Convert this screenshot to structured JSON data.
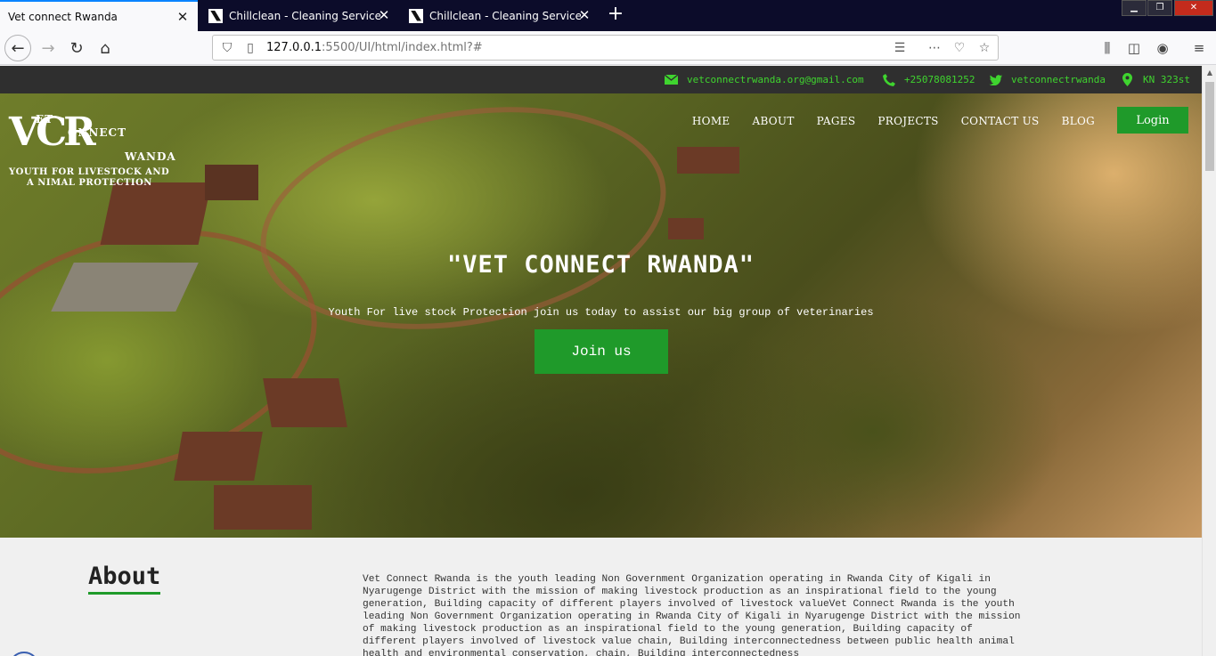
{
  "browser": {
    "tabs": [
      {
        "title": "Vet connect Rwanda",
        "active": true
      },
      {
        "title": "Chillclean - Cleaning Services H",
        "active": false
      },
      {
        "title": "Chillclean - Cleaning Services H",
        "active": false
      }
    ],
    "url_host": "127.0.0.1",
    "url_rest": ":5500/UI/html/index.html?#"
  },
  "topbar": {
    "email": "vetconnectrwanda.org@gmail.com",
    "phone": "+25078081252",
    "twitter": "vetconnectrwanda",
    "location": "KN 323st",
    "accent_color": "#3fd42f"
  },
  "logo": {
    "letters": "VCR",
    "word1": "ET",
    "word2": "ONNECT",
    "word3": "WANDA",
    "tagline1": "YOUTH FOR LIVESTOCK AND",
    "tagline2": "A NIMAL PROTECTION"
  },
  "nav": {
    "items": [
      "HOME",
      "ABOUT",
      "PAGES",
      "PROJECTS",
      "CONTACT US",
      "BLOG"
    ],
    "login": "Login"
  },
  "hero": {
    "title": "\"VET CONNECT RWANDA\"",
    "subtitle": "Youth For live stock Protection join us today to assist our big group of veterinaries",
    "cta": "Join us",
    "button_color": "#1f9a2a"
  },
  "about": {
    "heading": "About",
    "text": "Vet Connect Rwanda is the youth leading Non Government Organization operating in Rwanda City of Kigali in Nyarugenge District with the mission of making livestock production as an inspirational field to the young generation, Building capacity of different players involved of livestock valueVet Connect Rwanda is the youth leading Non Government Organization operating in Rwanda City of Kigali in Nyarugenge District with the mission of making livestock production as an inspirational field to the young generation, Building capacity of different players involved of livestock value chain, Building interconnectedness between public health animal health and environmental conservation, chain, Building interconnectedness"
  }
}
